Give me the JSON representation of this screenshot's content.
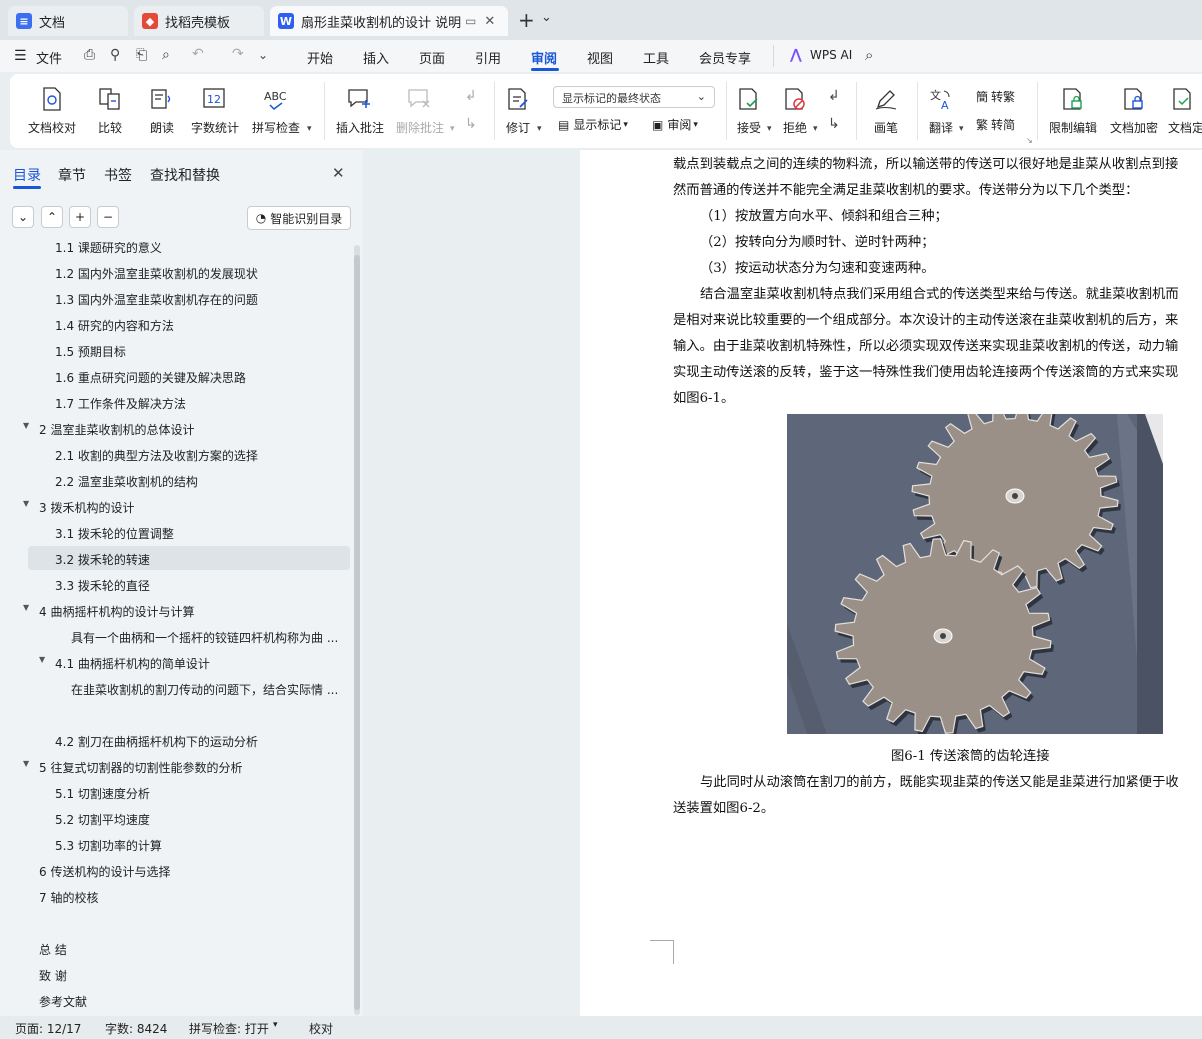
{
  "tabs": [
    {
      "label": "文档",
      "icon": "docs-icon"
    },
    {
      "label": "找稻壳模板",
      "icon": "docer-icon"
    },
    {
      "label": "扇形韭菜收割机的设计 说明书",
      "icon": "wps-writer-icon"
    }
  ],
  "tabbar": {
    "add_label": "+",
    "dropdown_label": "⌄"
  },
  "menu": {
    "file_label": "文件",
    "items": [
      "开始",
      "插入",
      "页面",
      "引用",
      "审阅",
      "视图",
      "工具",
      "会员专享"
    ],
    "active": "审阅",
    "wps_ai": "WPS AI"
  },
  "ribbon": {
    "doc_check": "文档校对",
    "compare": "比较",
    "read_aloud": "朗读",
    "word_count": "字数统计",
    "spell_check": "拼写检查",
    "insert_comment": "插入批注",
    "delete_comment": "删除批注",
    "track_changes": "修订",
    "markup_state": "显示标记的最终状态",
    "show_markup": "显示标记",
    "review": "审阅",
    "accept": "接受",
    "reject": "拒绝",
    "pen": "画笔",
    "translate": "翻译",
    "to_traditional": "转繁",
    "to_simplified": "转简",
    "restrict_edit": "限制编辑",
    "encrypt": "文档加密",
    "finalize": "文档定"
  },
  "panel": {
    "tabs": [
      "目录",
      "章节",
      "书签",
      "查找和替换"
    ],
    "active_tab": "目录",
    "smart_toc": "智能识别目录",
    "toc": [
      {
        "text": "1.1 课题研究的意义",
        "level": 2
      },
      {
        "text": "1.2 国内外温室韭菜收割机的发展现状",
        "level": 2
      },
      {
        "text": "1.3 国内外温室韭菜收割机存在的问题",
        "level": 2
      },
      {
        "text": "1.4 研究的内容和方法",
        "level": 2
      },
      {
        "text": "1.5 预期目标",
        "level": 2
      },
      {
        "text": "1.6 重点研究问题的关键及解决思路",
        "level": 2
      },
      {
        "text": "1.7 工作条件及解决方法",
        "level": 2
      },
      {
        "text": "2 温室韭菜收割机的总体设计",
        "level": 1,
        "arrow": "▼"
      },
      {
        "text": "2.1 收割的典型方法及收割方案的选择",
        "level": 2
      },
      {
        "text": "2.2 温室韭菜收割机的结构",
        "level": 2
      },
      {
        "text": "3 拨禾机构的设计",
        "level": 1,
        "arrow": "▼"
      },
      {
        "text": "3.1 拨禾轮的位置调整",
        "level": 2
      },
      {
        "text": "3.2 拨禾轮的转速",
        "level": 2,
        "selected": true
      },
      {
        "text": "3.3  拨禾轮的直径",
        "level": 2
      },
      {
        "text": "4 曲柄摇杆机构的设计与计算",
        "level": 1,
        "arrow": "▼"
      },
      {
        "text": "具有一个曲柄和一个摇杆的铰链四杆机构称为曲 ...",
        "level": 3
      },
      {
        "text": "4.1 曲柄摇杆机构的简单设计",
        "level": 2,
        "arrow": "▼"
      },
      {
        "text": "在韭菜收割机的割刀传动的问题下，结合实际情 ...",
        "level": 3
      },
      {
        "text": "",
        "level": 3
      },
      {
        "text": "4.2 割刀在曲柄摇杆机构下的运动分析",
        "level": 2
      },
      {
        "text": "5 往复式切割器的切割性能参数的分析",
        "level": 1,
        "arrow": "▼"
      },
      {
        "text": "5.1 切割速度分析",
        "level": 2
      },
      {
        "text": "5.2 切割平均速度",
        "level": 2
      },
      {
        "text": "5.3 切割功率的计算",
        "level": 2
      },
      {
        "text": "6 传送机构的设计与选择",
        "level": 1
      },
      {
        "text": "7  轴的校核",
        "level": 1
      },
      {
        "text": "",
        "level": 1
      },
      {
        "text": "总 结",
        "level": 1
      },
      {
        "text": "致 谢",
        "level": 1
      },
      {
        "text": "参考文献",
        "level": 1
      }
    ]
  },
  "document": {
    "lines": [
      {
        "text": "载点到装载点之间的连续的物料流，所以输送带的传送可以很好地是韭菜从收割点到接",
        "indent": 0
      },
      {
        "text": "然而普通的传送并不能完全满足韭菜收割机的要求。传送带分为以下几个类型：",
        "indent": 0
      },
      {
        "text": "（1）按放置方向水平、倾斜和组合三种；",
        "indent": 1
      },
      {
        "text": "（2）按转向分为顺时针、逆时针两种；",
        "indent": 1
      },
      {
        "text": "（3）按运动状态分为匀速和变速两种。",
        "indent": 1
      },
      {
        "text": "结合温室韭菜收割机特点我们采用组合式的传送类型来给与传送。就韭菜收割机而",
        "indent": 1
      },
      {
        "text": "是相对来说比较重要的一个组成部分。本次设计的主动传送滚在韭菜收割机的后方，来",
        "indent": 0
      },
      {
        "text": "输入。由于韭菜收割机特殊性，所以必须实现双传送来实现韭菜收割机的传送，动力输",
        "indent": 0
      },
      {
        "text": "实现主动传送滚的反转，鉴于这一特殊性我们使用齿轮连接两个传送滚筒的方式来实现",
        "indent": 0
      },
      {
        "text": "如图6-1。",
        "indent": 0
      }
    ],
    "caption": "图6-1 传送滚筒的齿轮连接",
    "after_lines": [
      {
        "text": "与此同时从动滚筒在割刀的前方，既能实现韭菜的传送又能是韭菜进行加紧便于收",
        "indent": 1
      },
      {
        "text": "送装置如图6-2。",
        "indent": 0
      }
    ]
  },
  "status": {
    "page": "页面: 12/17",
    "words": "字数: 8424",
    "spell": "拼写检查: 打开",
    "proof": "校对"
  },
  "colors": {
    "accent": "#1a56d8",
    "selected_row": "#dde3e7",
    "figure_bg": "#5e6779",
    "gear": "#9b9088"
  }
}
